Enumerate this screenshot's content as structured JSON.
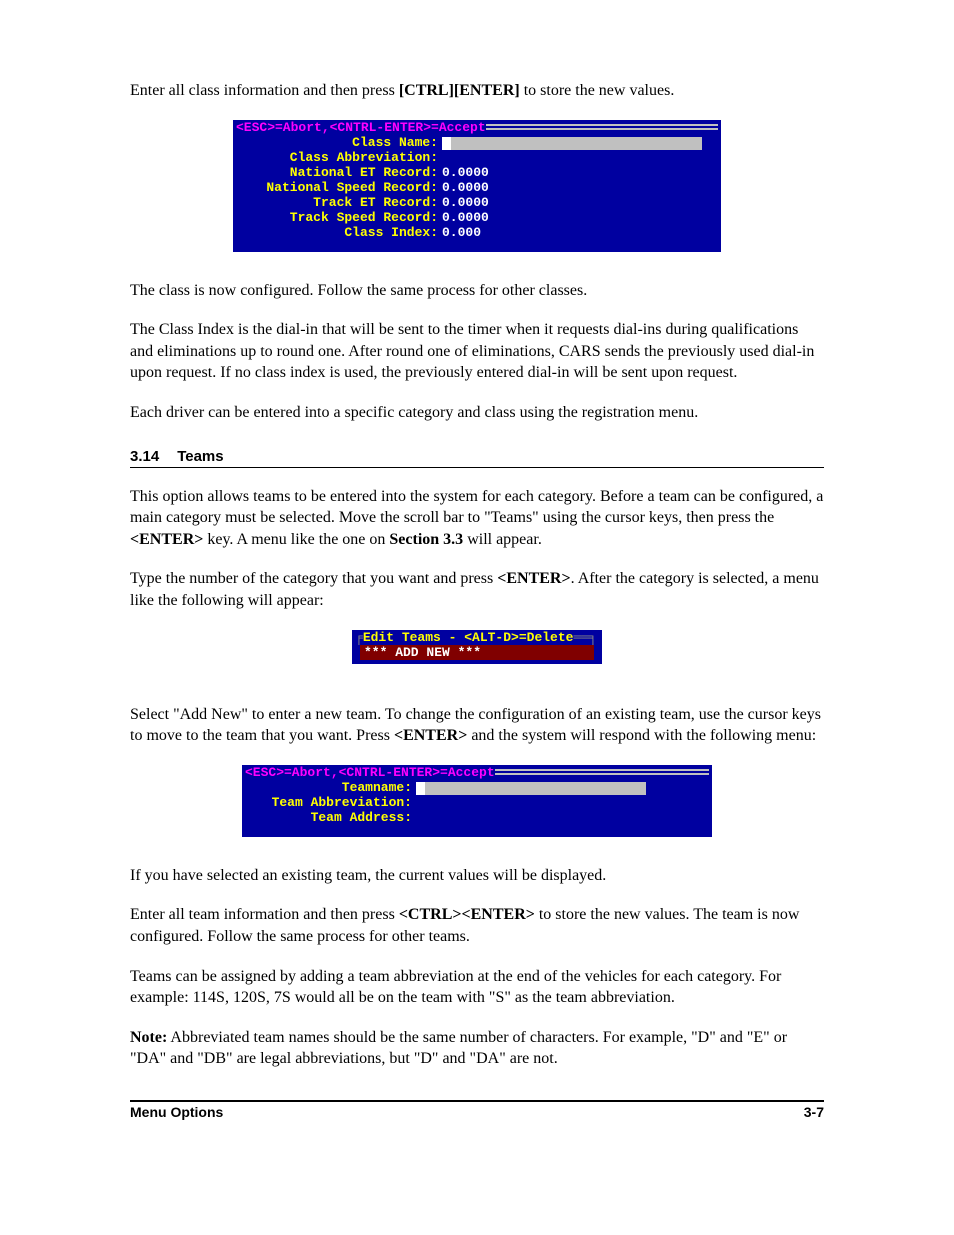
{
  "para1_a": "Enter all class information and then press ",
  "para1_b": "[CTRL][ENTER]",
  "para1_c": " to store the new values.",
  "screenshot1": {
    "title": "<ESC>=Abort,<CNTRL-ENTER>=Accept",
    "fields": [
      {
        "label": "Class Name:",
        "value": "",
        "input": true
      },
      {
        "label": "Class Abbreviation:",
        "value": "",
        "input": false
      },
      {
        "label": "National ET Record:",
        "value": "0.0000",
        "input": false
      },
      {
        "label": "National Speed Record:",
        "value": "0.0000",
        "input": false
      },
      {
        "label": "Track ET Record:",
        "value": "0.0000",
        "input": false
      },
      {
        "label": "Track Speed Record:",
        "value": "0.0000",
        "input": false
      },
      {
        "label": "Class Index:",
        "value": "0.000",
        "input": false
      }
    ]
  },
  "para2": "The class is now configured. Follow the same process for other classes.",
  "para3": "The Class Index is the dial-in that will be sent to the timer when it requests dial-ins during qualifications and eliminations up to round one. After round one of eliminations, CARS sends the previously used dial-in upon request. If no class index is used, the previously entered dial-in will be sent upon request.",
  "para4": "Each driver can be entered into a specific category and class using the registration menu.",
  "section": {
    "number": "3.14",
    "title": "Teams"
  },
  "para5_a": "This option allows teams to be entered into the system for each category. Before a team can be configured, a main category must be selected. Move the scroll bar to \"Teams\" using the cursor keys, then press the ",
  "para5_b": "<ENTER>",
  "para5_c": " key. A menu like the one on ",
  "para5_d": "Section 3.3",
  "para5_e": " will appear.",
  "para6_a": "Type the number of the category that you want and press ",
  "para6_b": "<ENTER>",
  "para6_c": ". After the category is selected, a menu like the following will appear:",
  "screenshot2": {
    "title": "Edit Teams - <ALT-D>=Delete",
    "row": "*** ADD NEW ***"
  },
  "para7_a": "Select \"Add New\" to enter a new team. To change the configuration of an existing team, use the cursor keys to move to the team that you want. Press ",
  "para7_b": "<ENTER>",
  "para7_c": " and the system will respond with the following menu:",
  "screenshot3": {
    "title": "<ESC>=Abort,<CNTRL-ENTER>=Accept",
    "fields": [
      {
        "label": "Teamname:",
        "value": "",
        "input": true
      },
      {
        "label": "Team Abbreviation:",
        "value": "",
        "input": false
      },
      {
        "label": "Team Address:",
        "value": "",
        "input": false
      }
    ]
  },
  "para8": "If you have selected an existing team, the current values will be displayed.",
  "para9_a": "Enter all team information and then press ",
  "para9_b": "<CTRL><ENTER>",
  "para9_c": " to store the new values. The team is now configured. Follow the same process for other teams.",
  "para10": "Teams can be assigned by adding a team abbreviation at the end of the vehicles for each category. For example: 114S, 120S, 7S would all be on the team with \"S\" as the team abbreviation.",
  "para11_a": "Note:",
  "para11_b": "   Abbreviated team names should be the same number of characters. For example, \"D\" and \"E\" or \"DA\" and \"DB\" are legal abbreviations, but \"D\" and \"DA\" are not.",
  "footer": {
    "left": "Menu Options",
    "right": "3-7"
  }
}
